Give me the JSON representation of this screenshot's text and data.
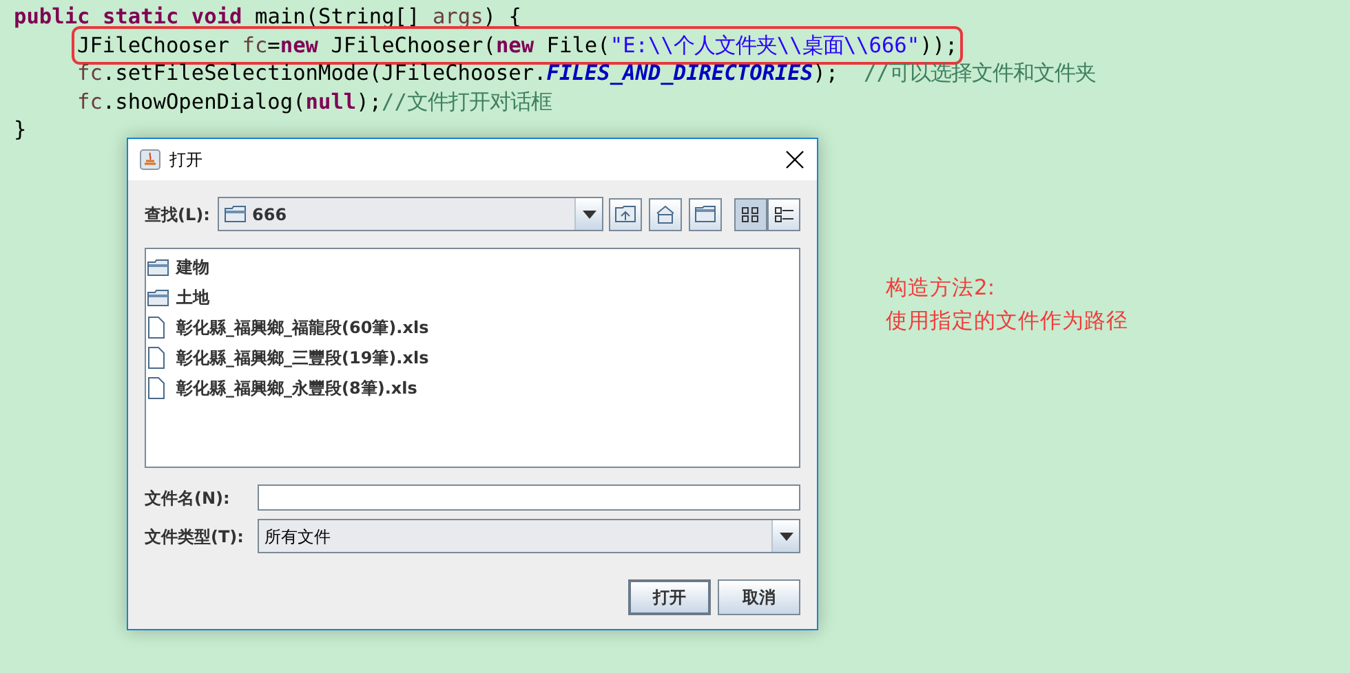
{
  "code": {
    "lines": [
      {
        "tokens": [
          {
            "kind": "keyword",
            "text": "public static void"
          },
          {
            "kind": "plain",
            "text": " main(String[] "
          },
          {
            "kind": "param",
            "text": "args"
          },
          {
            "kind": "plain",
            "text": ") {"
          }
        ]
      },
      {
        "highlighted": true,
        "tokens": [
          {
            "kind": "plain",
            "text": "\tJFileChooser "
          },
          {
            "kind": "variable",
            "text": "fc"
          },
          {
            "kind": "plain",
            "text": "="
          },
          {
            "kind": "keyword",
            "text": "new"
          },
          {
            "kind": "plain",
            "text": " JFileChooser("
          },
          {
            "kind": "keyword",
            "text": "new"
          },
          {
            "kind": "plain",
            "text": " File("
          },
          {
            "kind": "string",
            "text": "\"E:\\\\个人文件夹\\\\桌面\\\\666\""
          },
          {
            "kind": "plain",
            "text": "));"
          }
        ]
      },
      {
        "tokens": [
          {
            "kind": "variable",
            "text": "\tfc"
          },
          {
            "kind": "plain",
            "text": ".setFileSelectionMode(JFileChooser."
          },
          {
            "kind": "constant",
            "text": "FILES_AND_DIRECTORIES"
          },
          {
            "kind": "plain",
            "text": ");  "
          },
          {
            "kind": "comment",
            "text": "//可以选择文件和文件夹"
          }
        ]
      },
      {
        "tokens": [
          {
            "kind": "variable",
            "text": "\tfc"
          },
          {
            "kind": "plain",
            "text": ".showOpenDialog("
          },
          {
            "kind": "keyword",
            "text": "null"
          },
          {
            "kind": "plain",
            "text": ");"
          },
          {
            "kind": "comment",
            "text": "//文件打开对话框"
          }
        ]
      },
      {
        "tokens": [
          {
            "kind": "plain",
            "text": "}"
          }
        ]
      }
    ]
  },
  "dialog": {
    "title": "打开",
    "look_in_label": "查找(L):",
    "look_in_value": "666",
    "toolbar": [
      {
        "kind": "up",
        "selected": false
      },
      {
        "kind": "home",
        "selected": false
      },
      {
        "kind": "new-folder",
        "selected": false
      },
      {
        "kind": "list",
        "selected": true
      },
      {
        "kind": "details",
        "selected": false
      }
    ],
    "files": [
      {
        "kind": "folder",
        "name": "建物"
      },
      {
        "kind": "folder",
        "name": "土地"
      },
      {
        "kind": "file",
        "name": "彰化縣_福興鄉_福龍段(60筆).xls"
      },
      {
        "kind": "file",
        "name": "彰化縣_福興鄉_三豐段(19筆).xls"
      },
      {
        "kind": "file",
        "name": "彰化縣_福興鄉_永豐段(8筆).xls"
      }
    ],
    "file_name_label": "文件名(N):",
    "file_type_label": "文件类型(T):",
    "file_type_value": "所有文件",
    "buttons": [
      {
        "label": "打开",
        "default": true
      },
      {
        "label": "取消",
        "default": false
      }
    ]
  },
  "annotation": [
    "构造方法2:",
    "使用指定的文件作为路径"
  ]
}
